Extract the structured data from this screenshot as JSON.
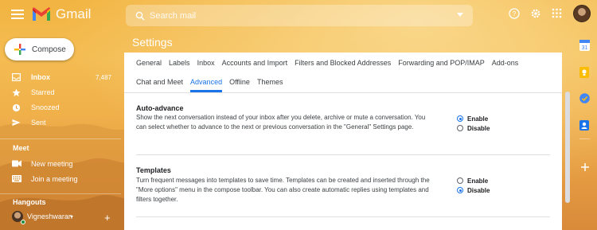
{
  "header": {
    "app_name": "Gmail",
    "search_placeholder": "Search mail"
  },
  "compose_label": "Compose",
  "sidebar": {
    "items": [
      {
        "label": "Inbox",
        "count": "7,487",
        "icon": "inbox-icon"
      },
      {
        "label": "Starred",
        "icon": "star-icon"
      },
      {
        "label": "Snoozed",
        "icon": "clock-icon"
      },
      {
        "label": "Sent",
        "icon": "send-icon"
      }
    ],
    "meet_title": "Meet",
    "meet_items": [
      {
        "label": "New meeting",
        "icon": "video-icon"
      },
      {
        "label": "Join a meeting",
        "icon": "keyboard-icon"
      }
    ],
    "hangouts_title": "Hangouts",
    "hangouts_user": "Vigneshwaran"
  },
  "settings": {
    "title": "Settings",
    "tabs_row1": [
      "General",
      "Labels",
      "Inbox",
      "Accounts and Import",
      "Filters and Blocked Addresses",
      "Forwarding and POP/IMAP",
      "Add-ons"
    ],
    "tabs_row2": [
      "Chat and Meet",
      "Advanced",
      "Offline",
      "Themes"
    ],
    "selected_tab": "Advanced",
    "options": [
      {
        "title": "Auto-advance",
        "description": "Show the next conversation instead of your inbox after you delete, archive or mute a conversation. You can select whether to advance to the next or previous conversation in the \"General\" Settings page.",
        "enable_label": "Enable",
        "disable_label": "Disable",
        "selected": "Enable"
      },
      {
        "title": "Templates",
        "description": "Turn frequent messages into templates to save time. Templates can be created and inserted through the \"More options\" menu in the compose toolbar. You can also create automatic replies using templates and filters together.",
        "enable_label": "Enable",
        "disable_label": "Disable",
        "selected": "Disable"
      }
    ]
  },
  "colors": {
    "accent": "#1a73e8",
    "background_theme": "#f2b441"
  }
}
